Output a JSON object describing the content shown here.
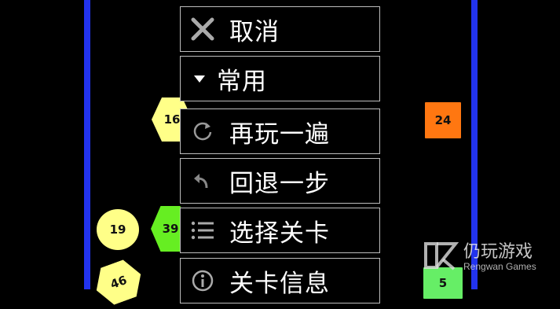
{
  "menu": {
    "items": [
      {
        "label": "取消",
        "icon": "close-icon"
      },
      {
        "label": "常用",
        "icon": "triangle-down-icon"
      },
      {
        "label": "再玩一遍",
        "icon": "refresh-icon"
      },
      {
        "label": "回退一步",
        "icon": "undo-icon"
      },
      {
        "label": "选择关卡",
        "icon": "list-icon"
      },
      {
        "label": "关卡信息",
        "icon": "info-icon"
      }
    ]
  },
  "pieces": [
    {
      "value": "16",
      "shape": "hexagon",
      "color": "#ffff88"
    },
    {
      "value": "24",
      "shape": "square",
      "color": "#ff7711"
    },
    {
      "value": "19",
      "shape": "circle",
      "color": "#ffff88"
    },
    {
      "value": "39",
      "shape": "hexagon",
      "color": "#66ee22"
    },
    {
      "value": "46",
      "shape": "hexagon",
      "color": "#ffff88"
    },
    {
      "value": "5",
      "shape": "square",
      "color": "#66ee66"
    }
  ],
  "walls": {
    "color": "#2233ee"
  },
  "watermark": {
    "title": "仍玩游戏",
    "subtitle": "Rengwan Games"
  }
}
